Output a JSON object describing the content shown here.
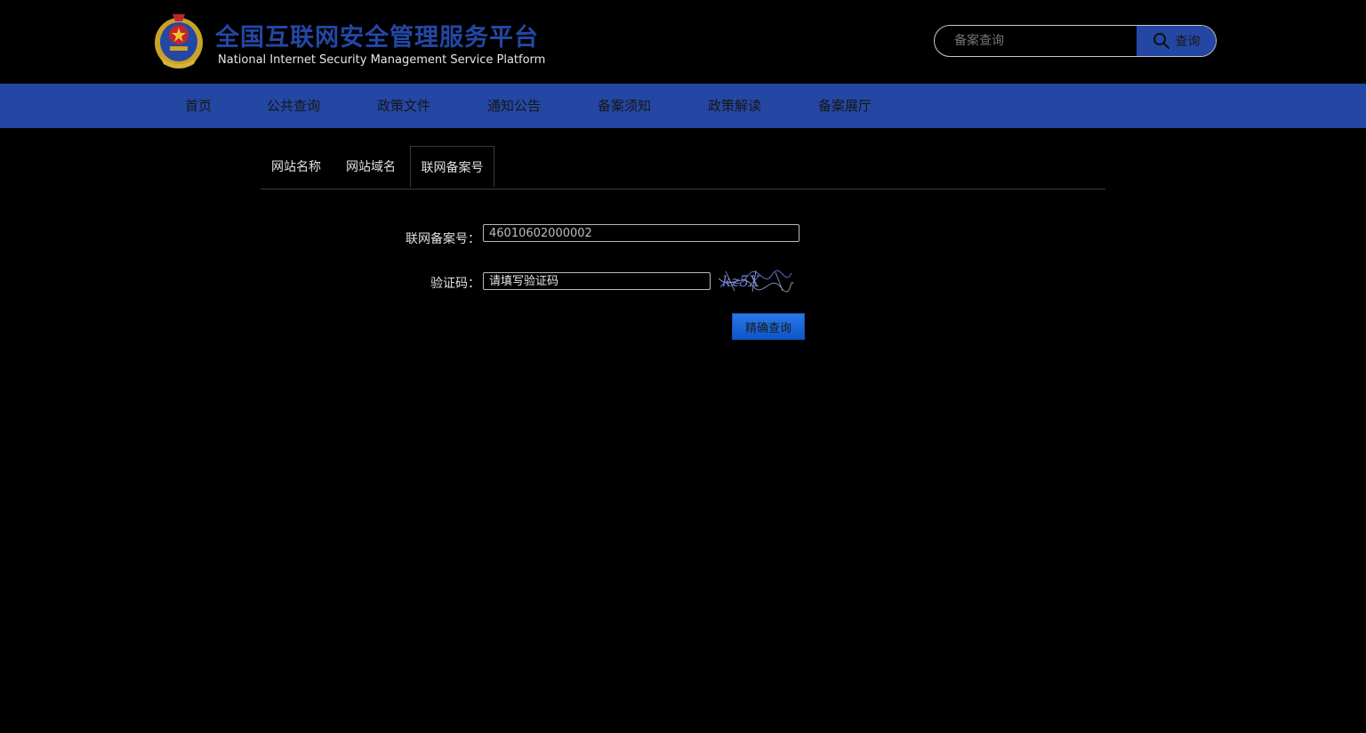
{
  "header": {
    "logo_cn": "全国互联网安全管理服务平台",
    "logo_en": "National Internet Security Management Service Platform",
    "emblem_icon": "police-emblem-icon",
    "search_placeholder": "备案查询",
    "search_button": "查询",
    "search_icon": "search-icon"
  },
  "nav": {
    "items": [
      "首页",
      "公共查询",
      "政策文件",
      "通知公告",
      "备案须知",
      "政策解读",
      "备案展厅"
    ]
  },
  "tabs": {
    "items": [
      "网站名称",
      "网站域名",
      "联网备案号"
    ],
    "active": "联网备案号"
  },
  "form": {
    "record_label": "联网备案号：",
    "record_value": "46010602000002",
    "captcha_label": "验证码：",
    "captcha_placeholder": "请填写验证码",
    "submit": "精确查询"
  },
  "colors": {
    "brand_blue": "#2447a3",
    "background": "#000000",
    "button_blue": "#1565d8"
  }
}
